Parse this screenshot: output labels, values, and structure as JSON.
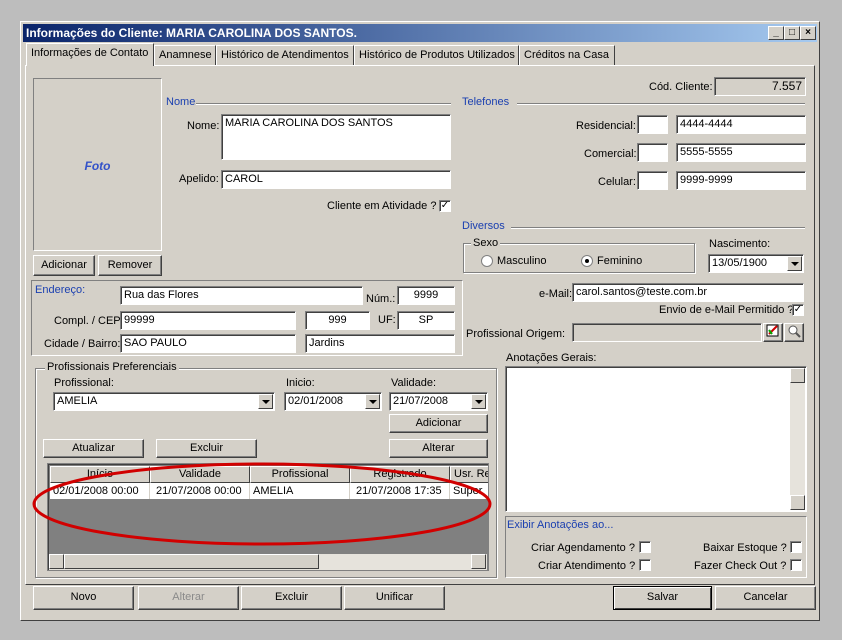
{
  "window": {
    "title": "Informações do Cliente: MARIA CAROLINA DOS SANTOS.",
    "controls": {
      "minimize": "_",
      "maximize": "□",
      "close": "×"
    }
  },
  "tabs": [
    "Informações de Contato",
    "Anamnese",
    "Histórico de Atendimentos",
    "Histórico de Produtos Utilizados",
    "Créditos na Casa"
  ],
  "client_code": {
    "label": "Cód. Cliente:",
    "value": "7.557"
  },
  "photo": {
    "label": "Foto",
    "add_button": "Adicionar",
    "remove_button": "Remover"
  },
  "name_section": {
    "title": "Nome",
    "nome_label": "Nome:",
    "nome_value": "MARIA CAROLINA DOS SANTOS",
    "apelido_label": "Apelido:",
    "apelido_value": "CAROL",
    "ativo_label": "Cliente em Atividade ?",
    "ativo_checked": "✓"
  },
  "phones": {
    "title": "Telefones",
    "residencial_label": "Residencial:",
    "residencial_value": "4444-4444",
    "comercial_label": "Comercial:",
    "comercial_value": "5555-5555",
    "celular_label": "Celular:",
    "celular_value": "9999-9999"
  },
  "diversos": {
    "title": "Diversos",
    "sexo_label": "Sexo",
    "masculino": "Masculino",
    "feminino": "Feminino",
    "nascimento_label": "Nascimento:",
    "nascimento_value": "13/05/1900",
    "email_label": "e-Mail:",
    "email_value": "carol.santos@teste.com.br",
    "email_perm_label": "Envio de e-Mail Permitido ?",
    "email_perm_checked": "✓",
    "origem_label": "Profissional Origem:"
  },
  "address": {
    "title": "Endereço:",
    "street": "Rua das Flores",
    "num_label": "Núm.:",
    "num_value": "9999",
    "compl_label": "Compl. / CEP:",
    "compl_value": "99999",
    "cep_value": "999",
    "uf_label": "UF:",
    "uf_value": "SP",
    "cidade_label": "Cidade / Bairro:",
    "cidade_value": "SAO PAULO",
    "bairro_value": "Jardins"
  },
  "professionals": {
    "title": "Profissionais Preferenciais",
    "profissional_label": "Profissional:",
    "profissional_value": "AMELIA",
    "inicio_label": "Inicio:",
    "inicio_value": "02/01/2008",
    "validade_label": "Validade:",
    "validade_value": "21/07/2008",
    "adicionar_button": "Adicionar",
    "atualizar_button": "Atualizar",
    "excluir_button": "Excluir",
    "alterar_button": "Alterar",
    "columns": [
      "Início",
      "Validade",
      "Profissional",
      "Registrado",
      "Usr. Re"
    ],
    "rows": [
      [
        "02/01/2008 00:00",
        "21/07/2008 00:00",
        "AMELIA",
        "21/07/2008 17:35",
        "Super"
      ]
    ]
  },
  "notes": {
    "title": "Anotações Gerais:",
    "show_title": "Exibir Anotações ao...",
    "criar_agendamento": "Criar Agendamento ?",
    "criar_atendimento": "Criar Atendimento ?",
    "baixar_estoque": "Baixar Estoque ?",
    "fazer_checkout": "Fazer Check Out ?"
  },
  "footer": {
    "novo": "Novo",
    "alterar": "Alterar",
    "excluir": "Excluir",
    "unificar": "Unificar",
    "salvar": "Salvar",
    "cancelar": "Cancelar"
  },
  "colors": {
    "highlight_ellipse": "#d10000",
    "title_start": "#0a246a",
    "section_blue": "#1a3fb0"
  }
}
